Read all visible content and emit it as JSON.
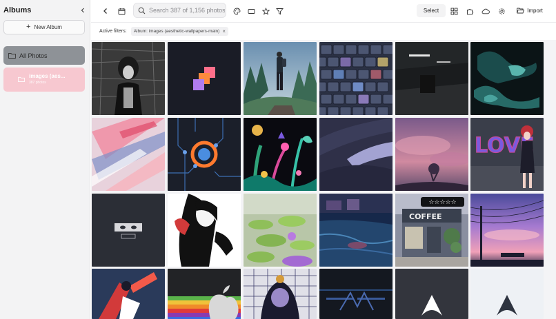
{
  "sidebar": {
    "title": "Albums",
    "new_album_label": "New Album",
    "albums": [
      {
        "name": "All Photos",
        "selected": true
      },
      {
        "name": "images (aes...",
        "count": "387 photos",
        "color": "#f7c8d0"
      }
    ]
  },
  "toolbar": {
    "search_placeholder": "Search 387 of 1,156 photos",
    "select_label": "Select",
    "import_label": "Import"
  },
  "filters": {
    "label": "Active filters:",
    "chip_label": "Album: images (aesthetic-wallpapers-main)"
  },
  "grid": {
    "rating_stars": "☆☆☆☆☆",
    "tiles": [
      {
        "subject": "anime girl monochrome manga"
      },
      {
        "subject": "orange pink purple squares logo"
      },
      {
        "subject": "man standing on cliff over forest"
      },
      {
        "subject": "mechanical keyboard keys"
      },
      {
        "subject": "dark parking garage"
      },
      {
        "subject": "dark teal fluid abstract"
      },
      {
        "subject": "pastel brush strokes"
      },
      {
        "subject": "circuit orange circle"
      },
      {
        "subject": "neon alien plants"
      },
      {
        "subject": "purple wave stripes"
      },
      {
        "subject": "pink sky clouds tree"
      },
      {
        "subject": "graffiti love girl"
      },
      {
        "subject": "eyes panel minimal"
      },
      {
        "subject": "manga girl hands"
      },
      {
        "subject": "lily pads pond"
      },
      {
        "subject": "pool night water"
      },
      {
        "subject": "coffee shop storefront",
        "text": "COFFEE"
      },
      {
        "subject": "purple pink sunset power lines"
      },
      {
        "subject": "red abstract figure"
      },
      {
        "subject": "rainbow apple logo"
      },
      {
        "subject": "hooded anime character grid"
      },
      {
        "subject": "dark glitch screen"
      },
      {
        "subject": "arch linux logo dark"
      },
      {
        "subject": "arch linux logo light"
      }
    ]
  },
  "colors": {
    "sidebar_bg": "#f3f3f4",
    "selected_album": "#8e9297",
    "album_pink": "#f7c8d0"
  }
}
